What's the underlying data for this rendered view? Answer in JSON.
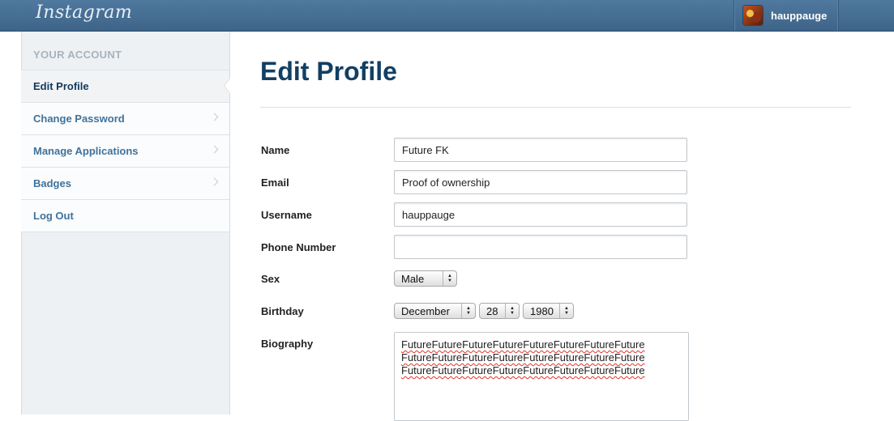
{
  "header": {
    "logo": "Instagram",
    "username": "hauppauge"
  },
  "sidebar": {
    "heading": "YOUR ACCOUNT",
    "items": [
      {
        "label": "Edit Profile"
      },
      {
        "label": "Change Password"
      },
      {
        "label": "Manage Applications"
      },
      {
        "label": "Badges"
      },
      {
        "label": "Log Out"
      }
    ]
  },
  "main": {
    "title": "Edit Profile",
    "fields": {
      "name": {
        "label": "Name",
        "value": "Future FK"
      },
      "email": {
        "label": "Email",
        "value": "Proof of ownership"
      },
      "username": {
        "label": "Username",
        "value": "hauppauge"
      },
      "phone": {
        "label": "Phone Number",
        "value": ""
      },
      "sex": {
        "label": "Sex",
        "value": "Male"
      },
      "birthday": {
        "label": "Birthday",
        "month": "December",
        "day": "28",
        "year": "1980"
      },
      "biography": {
        "label": "Biography",
        "lines": [
          "FutureFutureFutureFutureFutureFutureFutureFuture",
          "FutureFutureFutureFutureFutureFutureFutureFuture",
          "FutureFutureFutureFutureFutureFutureFutureFuture"
        ]
      }
    }
  }
}
